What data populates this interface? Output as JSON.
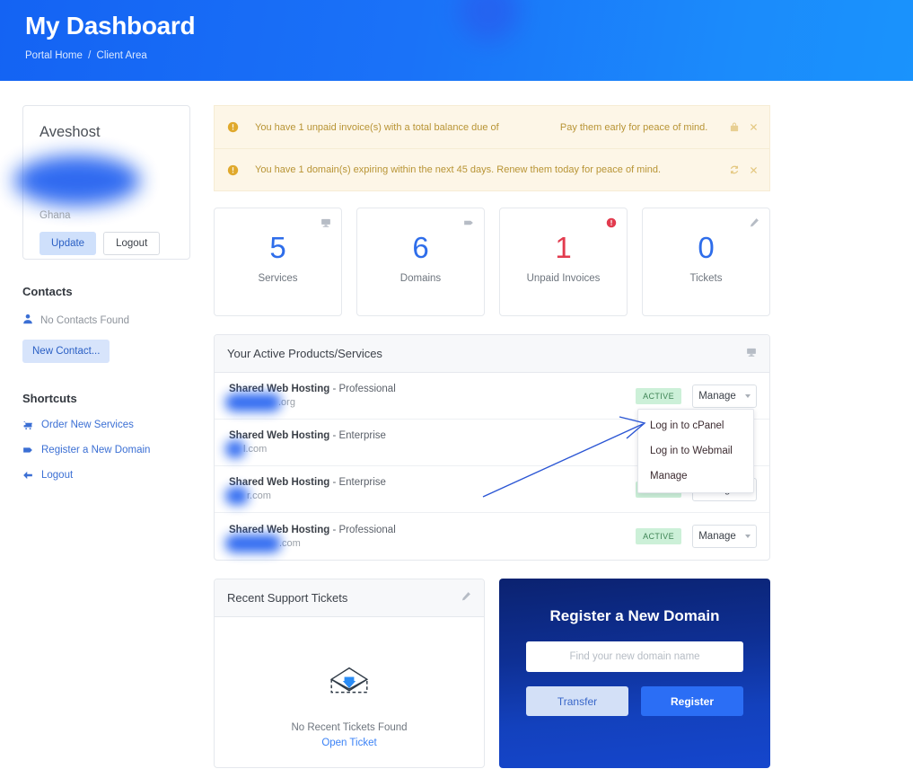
{
  "header": {
    "title": "My Dashboard",
    "breadcrumb": {
      "home": "Portal Home",
      "separator": "/",
      "current": "Client Area"
    },
    "gradient_from": "#1463f3",
    "gradient_to": "#1a93fc"
  },
  "sidebar": {
    "user_card": {
      "company": "Aveshost",
      "name_redacted": true,
      "country": "Ghana",
      "update_label": "Update",
      "logout_label": "Logout"
    },
    "contacts": {
      "heading": "Contacts",
      "empty_text": "No Contacts Found",
      "new_contact_label": "New Contact...",
      "icon": "user-icon"
    },
    "shortcuts": {
      "heading": "Shortcuts",
      "items": [
        {
          "label": "Order New Services",
          "icon": "cart-icon"
        },
        {
          "label": "Register a New Domain",
          "icon": "tag-icon"
        },
        {
          "label": "Logout",
          "icon": "arrow-left-icon"
        }
      ]
    }
  },
  "alerts": [
    {
      "text_before": "You have 1 unpaid invoice(s) with a total balance due of",
      "amount_redacted": true,
      "text_after": "Pay them early for peace of mind.",
      "action_icon": "cart-icon",
      "close_icon": "close-icon",
      "icon": "exclamation-circle-icon",
      "color": "#b89435",
      "background": "#fdf6e7"
    },
    {
      "text_before": "You have 1 domain(s) expiring within the next 45 days. Renew them today for peace of mind.",
      "amount_redacted": false,
      "text_after": "",
      "action_icon": "refresh-icon",
      "close_icon": "close-icon",
      "icon": "exclamation-circle-icon",
      "color": "#b89435",
      "background": "#fdf6e7"
    }
  ],
  "stats": [
    {
      "value": "5",
      "label": "Services",
      "icon": "server-icon",
      "danger": false
    },
    {
      "value": "6",
      "label": "Domains",
      "icon": "tag-icon",
      "danger": false
    },
    {
      "value": "1",
      "label": "Unpaid Invoices",
      "icon": "exclamation-circle-icon",
      "danger": true
    },
    {
      "value": "0",
      "label": "Tickets",
      "icon": "ticket-icon",
      "danger": false
    }
  ],
  "services_panel": {
    "title": "Your Active Products/Services",
    "icon": "server-icon",
    "manage_label": "Manage",
    "status_label": "ACTIVE",
    "rows": [
      {
        "product": "Shared Web Hosting",
        "plan": "- Professional",
        "domain_suffix": ".org",
        "redact_width": 62,
        "status": "ACTIVE",
        "show_status": true
      },
      {
        "product": "Shared Web Hosting",
        "plan": "- Enterprise",
        "domain_suffix": "l.com",
        "redact_width": 22,
        "status": "ACTIVE",
        "show_status": false
      },
      {
        "product": "Shared Web Hosting",
        "plan": "- Enterprise",
        "domain_suffix": "r.com",
        "redact_width": 30,
        "status": "ACTIVE",
        "show_status": true
      },
      {
        "product": "Shared Web Hosting",
        "plan": "- Professional",
        "domain_suffix": ".com",
        "redact_width": 62,
        "status": "ACTIVE",
        "show_status": true
      }
    ]
  },
  "dropdown": {
    "open": true,
    "items": [
      "Log in to cPanel",
      "Log in to Webmail",
      "Manage"
    ]
  },
  "annotation": {
    "type": "arrow",
    "color": "#2b56d4",
    "points_to": "Log in to cPanel"
  },
  "tickets_panel": {
    "title": "Recent Support Tickets",
    "icon": "ticket-icon",
    "empty_text": "No Recent Tickets Found",
    "link_label": "Open Ticket",
    "illustration": "empty-inbox-icon"
  },
  "register_domain": {
    "title": "Register a New Domain",
    "search_value": "",
    "search_placeholder": "Find your new domain name",
    "transfer_label": "Transfer",
    "register_label": "Register",
    "accent": "#2b6ef5"
  }
}
